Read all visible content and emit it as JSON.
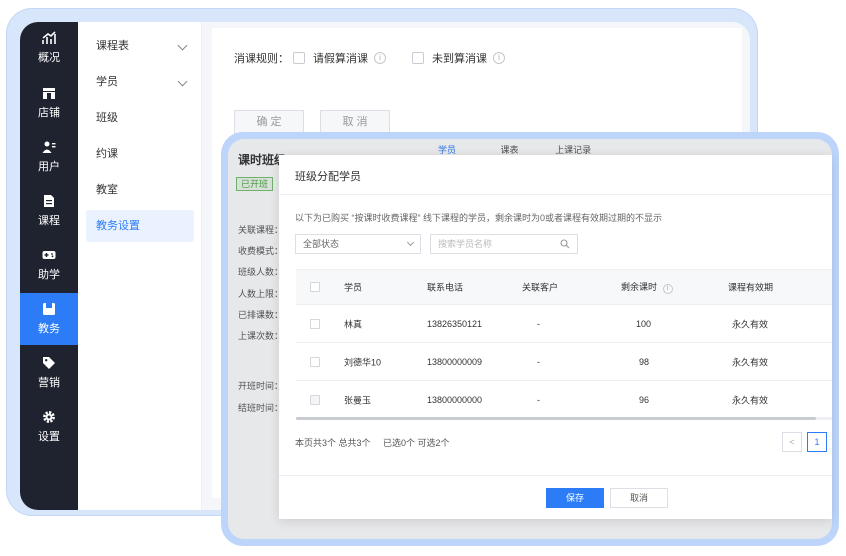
{
  "nav": {
    "items": [
      {
        "label": "概况",
        "icon": "overview-icon"
      },
      {
        "label": "店铺",
        "icon": "store-icon"
      },
      {
        "label": "用户",
        "icon": "users-icon"
      },
      {
        "label": "课程",
        "icon": "course-icon"
      },
      {
        "label": "助学",
        "icon": "gamepad-icon"
      },
      {
        "label": "教务",
        "icon": "academic-icon",
        "active": true
      },
      {
        "label": "营销",
        "icon": "tag-icon"
      },
      {
        "label": "设置",
        "icon": "gear-icon"
      }
    ]
  },
  "subnav": {
    "items": [
      {
        "label": "课程表",
        "expandable": true
      },
      {
        "label": "学员",
        "expandable": true
      },
      {
        "label": "班级"
      },
      {
        "label": "约课"
      },
      {
        "label": "教室"
      },
      {
        "label": "教务设置",
        "active": true
      }
    ]
  },
  "settings": {
    "rule_label": "消课规则：",
    "option_leave": "请假算消课",
    "option_absent": "未到算消课",
    "confirm_label": "确 定",
    "cancel_label": "取 消"
  },
  "class_window": {
    "title": "课时班级",
    "status_tag": "已开班",
    "tabs": [
      "学员",
      "课表",
      "上课记录"
    ],
    "fields": [
      "关联课程：",
      "收费模式：",
      "班级人数：",
      "人数上限：",
      "已排课数：",
      "上课次数：",
      "开班时间：",
      "结班时间："
    ]
  },
  "modal": {
    "title": "班级分配学员",
    "description": "以下为已购买 “按课时收费课程” 线下课程的学员，剩余课时为0或者课程有效期过期的不显示",
    "status_select": "全部状态",
    "search_placeholder": "搜索学员名称",
    "columns": [
      "学员",
      "联系电话",
      "关联客户",
      "剩余课时",
      "课程有效期"
    ],
    "rows": [
      {
        "name": "林真",
        "phone": "13826350121",
        "client": "-",
        "remaining": "100",
        "validity": "永久有效"
      },
      {
        "name": "刘德华10",
        "phone": "13800000009",
        "client": "-",
        "remaining": "98",
        "validity": "永久有效"
      },
      {
        "name": "张曼玉",
        "phone": "13800000000",
        "client": "-",
        "remaining": "96",
        "validity": "永久有效"
      }
    ],
    "pager_summary": "本页共3个 总共3个",
    "selected_summary": "已选0个 可选2个",
    "prev_label": "<",
    "page_number": "1",
    "save_label": "保存",
    "cancel_label": "取消"
  },
  "colors": {
    "primary": "#2b7cf6",
    "nav_bg": "#1f2330",
    "frame": "#bdd5fb",
    "status_green": "#4aa33f"
  }
}
